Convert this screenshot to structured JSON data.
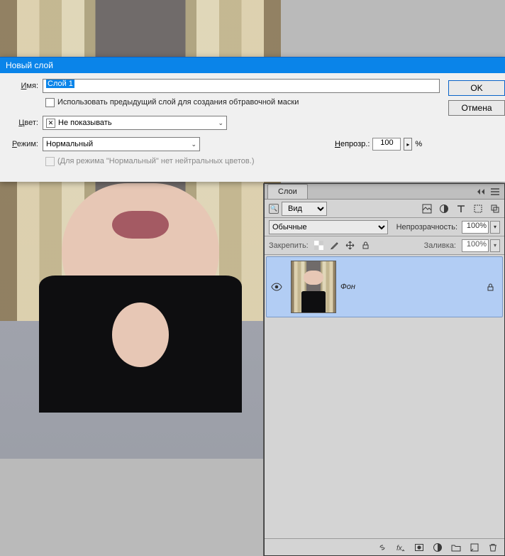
{
  "dialog": {
    "title": "Новый слой",
    "name_label": "Имя:",
    "name_value": "Слой 1",
    "clip_mask_label": "Использовать предыдущий слой для создания обтравочной маски",
    "clip_mask_checked": false,
    "color_label": "Цвет:",
    "color_value": "Не показывать",
    "mode_label": "Режим:",
    "mode_value": "Нормальный",
    "opacity_label": "Непрозр.:",
    "opacity_value": "100",
    "opacity_unit": "%",
    "neutral_note": "(Для режима \"Нормальный\" нет нейтральных цветов.)",
    "ok_label": "OK",
    "cancel_label": "Отмена"
  },
  "layers_panel": {
    "tab_label": "Слои",
    "filter_kind": "Вид",
    "blend_mode": "Обычные",
    "opacity_label": "Непрозрачность:",
    "opacity_value": "100%",
    "lock_label": "Закрепить:",
    "fill_label": "Заливка:",
    "fill_value": "100%",
    "layers": [
      {
        "name": "Фон",
        "visible": true,
        "locked": true
      }
    ]
  }
}
